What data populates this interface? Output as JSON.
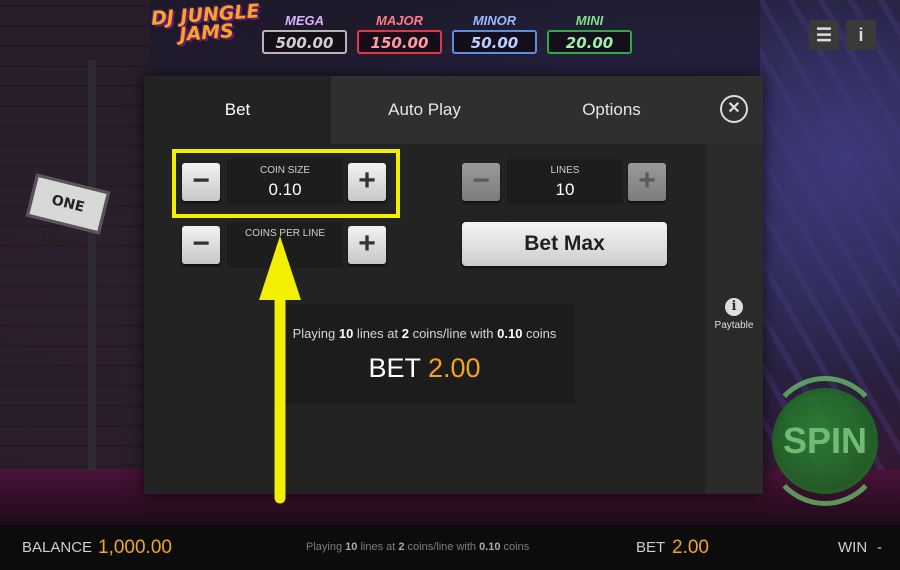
{
  "game": {
    "logo_text": "DJ JUNGLE JAMS",
    "sign_text": "ONE WAY"
  },
  "jackpots": [
    {
      "label": "MEGA",
      "value": "500.00"
    },
    {
      "label": "MAJOR",
      "value": "150.00"
    },
    {
      "label": "MINOR",
      "value": "50.00"
    },
    {
      "label": "MINI",
      "value": "20.00"
    }
  ],
  "top_buttons": {
    "menu_icon": "hamburger-icon",
    "menu_glyph": "☰",
    "info_icon": "info-icon",
    "info_glyph": "i"
  },
  "modal": {
    "tabs": [
      {
        "label": "Bet",
        "active": true
      },
      {
        "label": "Auto Play",
        "active": false
      },
      {
        "label": "Options",
        "active": false
      }
    ],
    "close_glyph": "✕",
    "coin_size": {
      "label": "COIN SIZE",
      "value": "0.10",
      "minus": "−",
      "plus": "+"
    },
    "coins_per_line": {
      "label": "COINS PER LINE",
      "value": "",
      "minus": "−",
      "plus": "+"
    },
    "lines": {
      "label": "LINES",
      "value": "10",
      "minus": "−",
      "plus": "+",
      "controls_disabled": true
    },
    "bet_max_label": "Bet Max",
    "summary": {
      "prefix": "Playing ",
      "lines": "10",
      "mid1": " lines at ",
      "coins": "2",
      "mid2": " coins/line with ",
      "coin_value": "0.10",
      "suffix": " coins",
      "bet_word": "BET",
      "bet_amount": "2.00"
    },
    "paytable": {
      "icon": "info-icon",
      "glyph": "i",
      "label": "Paytable"
    }
  },
  "spin_label": "SPIN",
  "bottom_bar": {
    "balance_label": "BALANCE",
    "balance_value": "1,000.00",
    "info": {
      "prefix": "Playing ",
      "lines": "10",
      "mid1": " lines at ",
      "coins": "2",
      "mid2": " coins/line with ",
      "coin_value": "0.10",
      "suffix": " coins"
    },
    "bet_label": "BET",
    "bet_value": "2.00",
    "win_label": "WIN",
    "win_value": "-"
  },
  "colors": {
    "highlight": "#f2f000",
    "accent_orange": "#f2a623",
    "spin_green": "#2e8a34"
  }
}
